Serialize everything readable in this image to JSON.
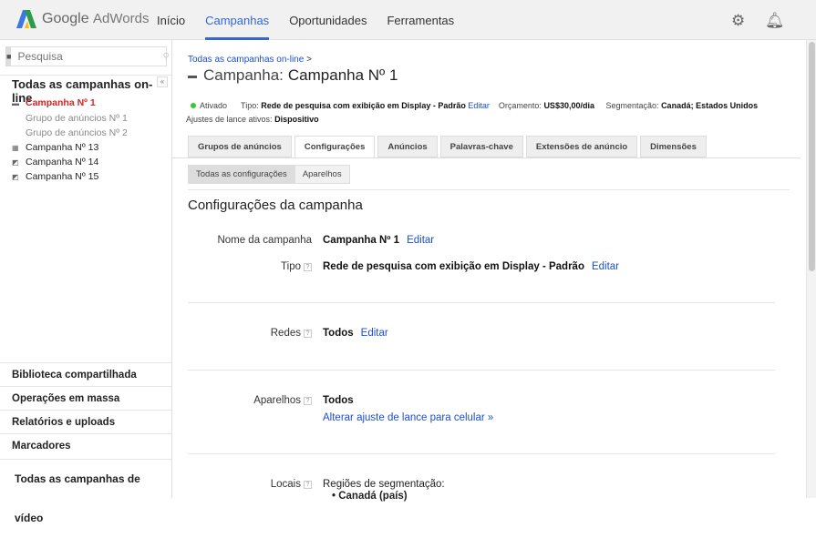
{
  "header": {
    "brand_google": "Google",
    "brand_adwords": "AdWords",
    "nav": [
      {
        "label": "Início"
      },
      {
        "label": "Campanhas"
      },
      {
        "label": "Oportunidades"
      },
      {
        "label": "Ferramentas"
      }
    ]
  },
  "sidebar": {
    "search_placeholder": "Pesquisa",
    "title": "Todas as campanhas on-line",
    "tree": [
      "Campanha Nº 1",
      "Grupo de anúncios Nº 1",
      "Grupo de anúncios Nº 2",
      "Campanha Nº 13",
      "Campanha Nº 14",
      "Campanha Nº 15"
    ],
    "links": [
      "Biblioteca compartilhada",
      "Operações em massa",
      "Relatórios e uploads",
      "Marcadores",
      "Todas as campanhas de vídeo"
    ]
  },
  "main": {
    "breadcrumb": "Todas as campanhas on-line",
    "breadcrumb_sep": ">",
    "title_prefix": "Campanha:",
    "title": "Campanha Nº 1",
    "status": "Ativado",
    "type_label": "Tipo:",
    "type_value": "Rede de pesquisa com exibição em Display - Padrão",
    "edit": "Editar",
    "budget_label": "Orçamento:",
    "budget_value": "US$30,00/dia",
    "targeting_label": "Segmentação:",
    "targeting_value": "Canadá; Estados Unidos",
    "bid_label": "Ajustes de lance ativos:",
    "bid_value": "Dispositivo",
    "tabs": [
      "Grupos de anúncios",
      "Configurações",
      "Anúncios",
      "Palavras-chave",
      "Extensões de anúncio",
      "Dimensões"
    ],
    "subtabs": [
      "Todas as configurações",
      "Aparelhos"
    ],
    "section_title": "Configurações da campanha",
    "settings": {
      "name_label": "Nome da campanha",
      "name_value": "Campanha Nº 1",
      "type_label": "Tipo",
      "type_value": "Rede de pesquisa com exibição em Display - Padrão",
      "networks_label": "Redes",
      "networks_value": "Todos",
      "devices_label": "Aparelhos",
      "devices_value": "Todos",
      "devices_link": "Alterar ajuste de lance para celular »",
      "locations_label": "Locais",
      "locations_value": "Regiões de segmentação:",
      "locations_item": "Canadá (país)",
      "edit": "Editar",
      "help": "?"
    }
  }
}
